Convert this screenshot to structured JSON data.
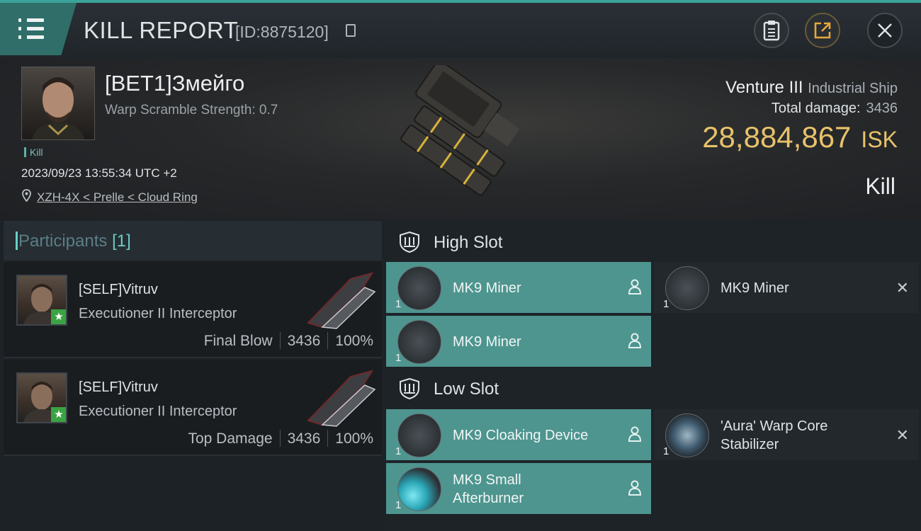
{
  "header": {
    "title": "KILL REPORT",
    "id_text": "[ID:8875120]"
  },
  "victim": {
    "name": "[BET1]Змейго",
    "warp_scramble": "Warp Scramble Strength: 0.7",
    "tag": "Kill",
    "datetime": "2023/09/23 13:55:34 UTC +2",
    "location": "XZH-4X < Prelle < Cloud Ring",
    "ship_name": "Venture III",
    "ship_class": "Industrial Ship",
    "total_damage_label": "Total damage:",
    "total_damage": "3436",
    "isk_value": "28,884,867",
    "isk_unit": "ISK",
    "result": "Kill"
  },
  "participants": {
    "label": "Participants",
    "count": "[1]",
    "rows": [
      {
        "name": "[SELF]Vitruv",
        "ship": "Executioner II Interceptor",
        "role": "Final Blow",
        "damage": "3436",
        "percent": "100%",
        "badge": "★"
      },
      {
        "name": "[SELF]Vitruv",
        "ship": "Executioner II Interceptor",
        "role": "Top Damage",
        "damage": "3436",
        "percent": "100%",
        "badge": "★"
      }
    ]
  },
  "slots": {
    "high_label": "High Slot",
    "low_label": "Low Slot",
    "high": [
      {
        "name": "MK9 Miner",
        "qty": "1"
      },
      {
        "name": "MK9 Miner",
        "qty": "1"
      },
      {
        "name": "MK9 Miner",
        "qty": "1"
      }
    ],
    "low": [
      {
        "name": "MK9 Cloaking Device",
        "qty": "1"
      },
      {
        "name_line1": "'Aura' Warp Core",
        "name_line2": "Stabilizer",
        "qty": "1"
      },
      {
        "name_line1": "MK9 Small",
        "name_line2": "Afterburner",
        "qty": "1"
      }
    ]
  },
  "colors": {
    "accent": "#4e958f",
    "isk": "#e8c26a",
    "badge_green": "#3aa343"
  },
  "icons": [
    "menu-icon",
    "clipboard-icon",
    "share-icon",
    "close-icon",
    "copy-icon",
    "location-pin-icon",
    "slot-shield-icon",
    "person-icon",
    "remove-x-icon",
    "star-icon"
  ]
}
